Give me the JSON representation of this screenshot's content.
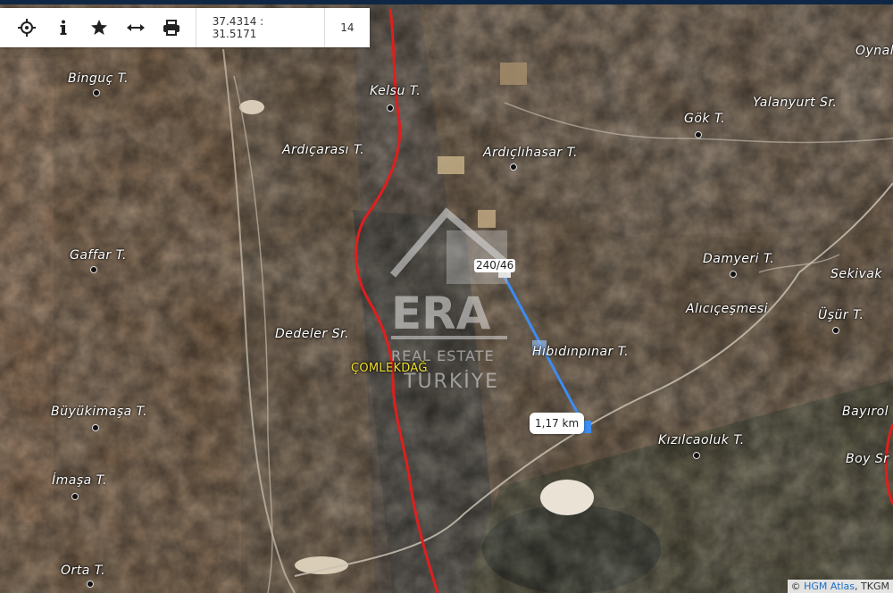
{
  "toolbar": {
    "buttons": [
      {
        "name": "locate",
        "icon": "crosshair-icon"
      },
      {
        "name": "info",
        "icon": "info-icon"
      },
      {
        "name": "favorite",
        "icon": "star-icon"
      },
      {
        "name": "measure",
        "icon": "measure-arrows-icon"
      },
      {
        "name": "print",
        "icon": "printer-icon"
      }
    ],
    "coordinates": "37.4314 : 31.5171",
    "zoom": "14"
  },
  "places": {
    "binguc": "Binguç T.",
    "kelsu": "Kelsu T.",
    "oynala": "Oynal",
    "yalanyurt": "Yalanyurt Sr.",
    "gok": "Gök T.",
    "ardicarasi": "Ardıçarası T.",
    "ardiclihasar": "Ardıçlıhasar T.",
    "gaffar": "Gaffar T.",
    "damyeri": "Damyeri T.",
    "sekivak": "Sekivak",
    "alicicesmesi": "Alıcıçeşmesi",
    "usur": "Üşür T.",
    "dedeler": "Dedeler Sr.",
    "comlekdag": "ÇOMLEKDAĞ",
    "hibidinpinar": "Hıbıdınpınar T.",
    "buyukimasa": "Büyükimaşa T.",
    "bayirol": "Bayırol",
    "kizilcaoluk": "Kızılcaoluk T.",
    "boy": "Boy Sr",
    "imasa": "İmaşa T.",
    "orta": "Orta T."
  },
  "parcel_label": "240/46",
  "distance_label": "1,17 km",
  "watermark": {
    "brand": "ERA",
    "line1": "REAL ESTATE",
    "line2": "TÜRKİYE"
  },
  "attribution": {
    "prefix": "©",
    "link": "HGM Atlas",
    "suffix": ", TKGM"
  },
  "colors": {
    "border_line": "#e01e1e",
    "measure_line": "#3d8cf0",
    "village_label": "#f2e02a"
  }
}
